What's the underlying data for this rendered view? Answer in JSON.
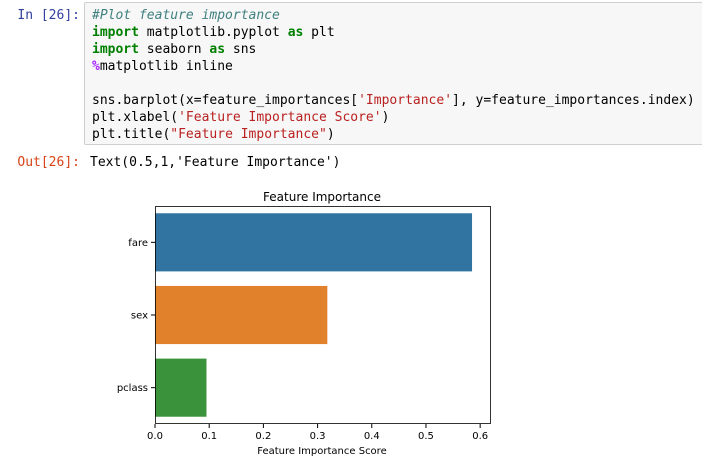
{
  "input_cell": {
    "prompt": "In [26]:",
    "lines": [
      [
        {
          "t": "#Plot feature importance",
          "c": "cm"
        }
      ],
      [
        {
          "t": "import",
          "c": "kw"
        },
        {
          "t": " matplotlib.pyplot "
        },
        {
          "t": "as",
          "c": "kw"
        },
        {
          "t": " plt"
        }
      ],
      [
        {
          "t": "import",
          "c": "kw"
        },
        {
          "t": " seaborn "
        },
        {
          "t": "as",
          "c": "kw"
        },
        {
          "t": " sns"
        }
      ],
      [
        {
          "t": "%",
          "c": "op"
        },
        {
          "t": "matplotlib inline"
        }
      ],
      [],
      [
        {
          "t": "sns.barplot(x=feature_importances["
        },
        {
          "t": "'Importance'",
          "c": "st"
        },
        {
          "t": "], y=feature_importances.index)"
        }
      ],
      [
        {
          "t": "plt.xlabel("
        },
        {
          "t": "'Feature Importance Score'",
          "c": "st"
        },
        {
          "t": ")"
        }
      ],
      [
        {
          "t": "plt.title("
        },
        {
          "t": "\"Feature Importance\"",
          "c": "st"
        },
        {
          "t": ")"
        }
      ]
    ]
  },
  "output_cell": {
    "prompt": "Out[26]:",
    "text": "Text(0.5,1,'Feature Importance')"
  },
  "chart_data": {
    "type": "bar",
    "orientation": "horizontal",
    "title": "Feature Importance",
    "xlabel": "Feature Importance Score",
    "ylabel": "",
    "categories": [
      "fare",
      "sex",
      "pclass"
    ],
    "values": [
      0.585,
      0.318,
      0.095
    ],
    "colors": [
      "#3274a1",
      "#e1812c",
      "#3a923a"
    ],
    "xlim": [
      0,
      0.62
    ],
    "xticks": [
      0.0,
      0.1,
      0.2,
      0.3,
      0.4,
      0.5,
      0.6
    ],
    "xtick_labels": [
      "0.0",
      "0.1",
      "0.2",
      "0.3",
      "0.4",
      "0.5",
      "0.6"
    ],
    "grid": false
  }
}
